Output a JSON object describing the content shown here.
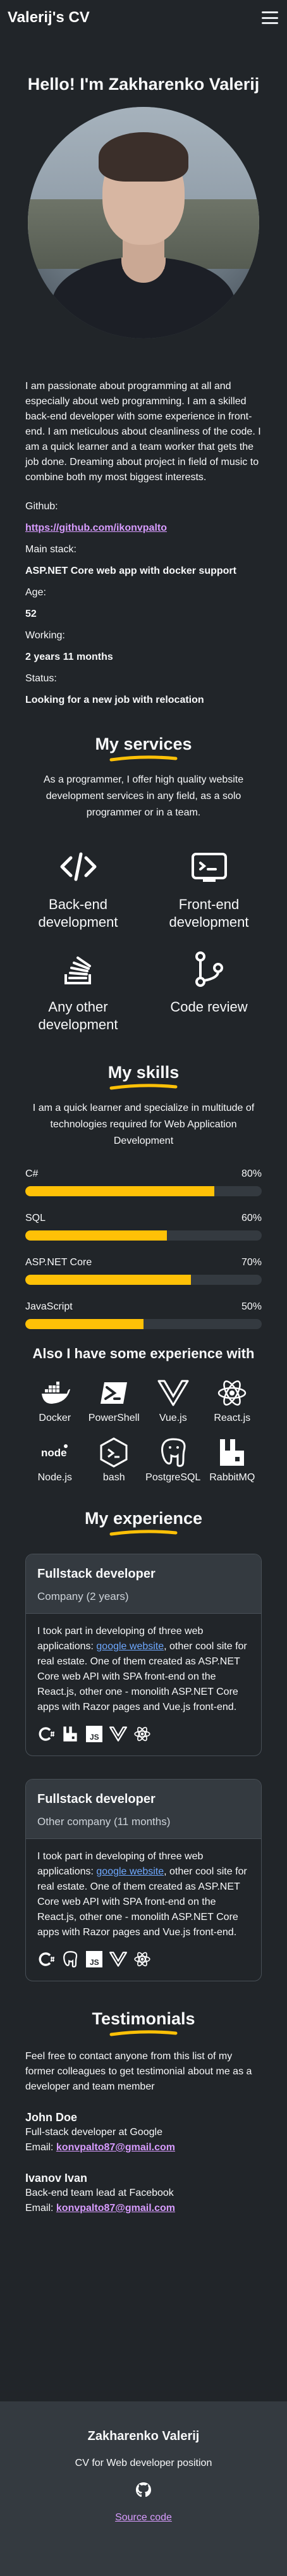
{
  "navbar": {
    "brand": "Valerij's CV",
    "menu_icon": "hamburger-menu-icon"
  },
  "hero": {
    "title": "Hello! I'm Zakharenko Valerij"
  },
  "about": "I am passionate about programming at all and especially about web programming. I am a skilled back-end developer with some experience in front-end. I am meticulous about cleanliness of the code. I am a quick learner and a team worker that gets the job done. Dreaming about project in field of music to combine both my most biggest interests.",
  "info": {
    "github_label": "Github:",
    "github_link": "https://github.com/ikonvpalto",
    "stack_label": "Main stack:",
    "stack_value": "ASP.NET Core web app with docker support",
    "age_label": "Age:",
    "age_value": "52",
    "working_label": "Working:",
    "working_value": "2 years 11 months",
    "status_label": "Status:",
    "status_value": "Looking for a new job with relocation"
  },
  "services": {
    "title": "My services",
    "intro": "As a programmer, I offer high quality website development services in any field, as a solo programmer or in a team.",
    "items": [
      {
        "name": "Back-end development",
        "icon": "code-icon"
      },
      {
        "name": "Front-end development",
        "icon": "terminal-icon"
      },
      {
        "name": "Any other development",
        "icon": "stack-icon"
      },
      {
        "name": "Code review",
        "icon": "git-branch-icon"
      }
    ]
  },
  "skills": {
    "title": "My skills",
    "intro": "I am a quick learner and specialize in multitude of technologies required for Web Application Development",
    "items": [
      {
        "name": "C#",
        "percent": "80%",
        "value": 80
      },
      {
        "name": "SQL",
        "percent": "60%",
        "value": 60
      },
      {
        "name": "ASP.NET Core",
        "percent": "70%",
        "value": 70
      },
      {
        "name": "JavaScript",
        "percent": "50%",
        "value": 50
      }
    ],
    "experience_title": "Also I have some experience with",
    "tools": [
      "Docker",
      "PowerShell",
      "Vue.js",
      "React.js",
      "Node.js",
      "bash",
      "PostgreSQL",
      "RabbitMQ"
    ]
  },
  "experience": {
    "title": "My experience",
    "jobs": [
      {
        "role": "Fullstack developer",
        "company": "Company (2 years)",
        "desc_before": "I took part in developing of three web applications: ",
        "link": "google website",
        "desc_after": ", other cool site for real estate. One of them created as ASP.NET Core web API with SPA front-end on the React.js, other one - monolith ASP.NET Core apps with Razor pages and Vue.js front-end."
      },
      {
        "role": "Fullstack developer",
        "company": "Other company (11 months)",
        "desc_before": "I took part in developing of three web applications: ",
        "link": "google website",
        "desc_after": ", other cool site for real estate. One of them created as ASP.NET Core web API with SPA front-end on the React.js, other one - monolith ASP.NET Core apps with Razor pages and Vue.js front-end."
      }
    ]
  },
  "testimonials": {
    "title": "Testimonials",
    "intro": "Feel free to contact anyone from this list of my former colleagues to get testimonial about me as a developer and team member",
    "people": [
      {
        "name": "John Doe",
        "role": "Full-stack developer at Google",
        "email_label": "Email: ",
        "email": "konvpalto87@gmail.com"
      },
      {
        "name": "Ivanov Ivan",
        "role": "Back-end team lead at Facebook",
        "email_label": "Email: ",
        "email": "konvpalto87@gmail.com"
      }
    ]
  },
  "footer": {
    "name": "Zakharenko Valerij",
    "desc": "CV for Web developer position",
    "source": "Source code"
  },
  "colors": {
    "accent": "#ffc107",
    "background": "#212529",
    "card_header": "#343a40",
    "link": "#d89cff"
  }
}
